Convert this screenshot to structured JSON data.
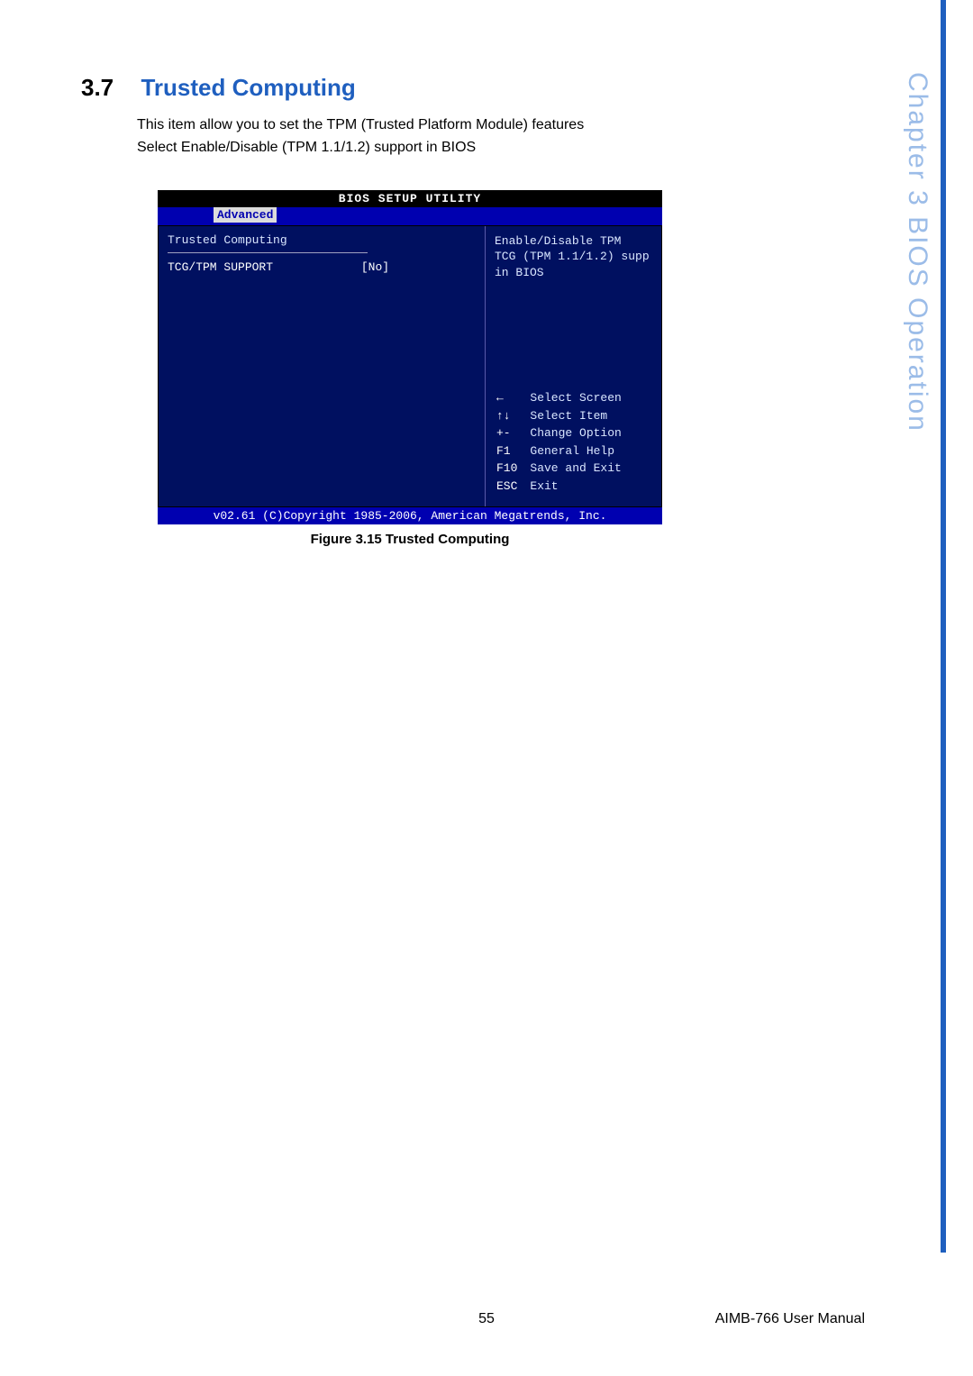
{
  "side_caption": "Chapter 3   BIOS Operation",
  "section": {
    "number": "3.7",
    "title": "Trusted Computing"
  },
  "body_lines": [
    "This item allow you to set the TPM (Trusted Platform Module) features",
    "Select Enable/Disable  (TPM 1.1/1.2) support in BIOS"
  ],
  "bios": {
    "title": "BIOS SETUP UTILITY",
    "tab": "Advanced",
    "heading": "Trusted Computing",
    "option_label": "TCG/TPM SUPPORT",
    "option_value": "[No]",
    "help_lines": [
      "Enable/Disable TPM",
      "TCG (TPM 1.1/1.2) supp",
      "in BIOS"
    ],
    "keys": [
      {
        "k": "←",
        "d": "Select Screen"
      },
      {
        "k": "↑↓",
        "d": "Select Item"
      },
      {
        "k": "+-",
        "d": "Change Option"
      },
      {
        "k": "F1",
        "d": "General Help"
      },
      {
        "k": "F10",
        "d": "Save and Exit"
      },
      {
        "k": "ESC",
        "d": "Exit"
      }
    ],
    "footer": "v02.61 (C)Copyright 1985-2006, American Megatrends, Inc."
  },
  "figure_caption": "Figure 3.15 Trusted Computing",
  "page_number": "55",
  "manual": "AIMB-766 User Manual"
}
